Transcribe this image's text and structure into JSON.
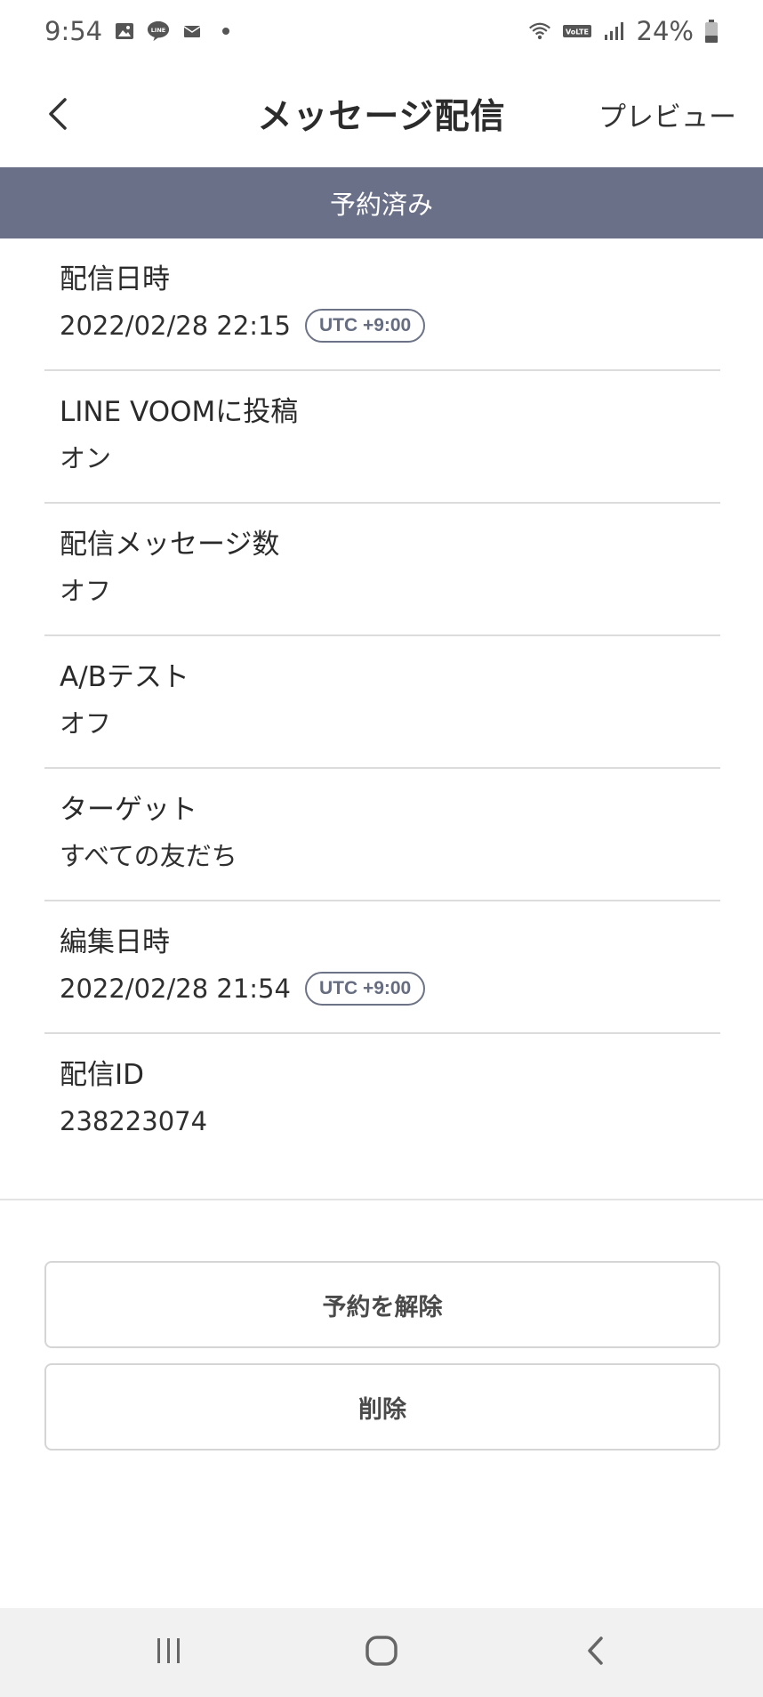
{
  "status_bar": {
    "time": "9:54",
    "battery": "24%",
    "left_icons": [
      "image-icon",
      "line-app-icon",
      "mail-icon",
      "dot-icon"
    ],
    "right_icons": [
      "wifi-icon",
      "volte-icon",
      "signal-icon",
      "battery-icon"
    ]
  },
  "header": {
    "title": "メッセージ配信",
    "back_icon": "chevron-left-icon",
    "preview_label": "プレビュー"
  },
  "banner": {
    "status_text": "予約済み",
    "color": "#6a7088"
  },
  "details": [
    {
      "label": "配信日時",
      "value": "2022/02/28 22:15",
      "badge": "UTC +9:00"
    },
    {
      "label": "LINE VOOMに投稿",
      "value": "オン"
    },
    {
      "label": "配信メッセージ数",
      "value": "オフ"
    },
    {
      "label": "A/Bテスト",
      "value": "オフ"
    },
    {
      "label": "ターゲット",
      "value": "すべての友だち"
    },
    {
      "label": "編集日時",
      "value": "2022/02/28 21:54",
      "badge": "UTC +9:00"
    },
    {
      "label": "配信ID",
      "value": "238223074"
    }
  ],
  "actions": {
    "cancel_reservation_label": "予約を解除",
    "delete_label": "削除"
  },
  "nav_bar": {
    "recent_icon": "recent-apps-icon",
    "home_icon": "home-icon",
    "back_icon": "back-icon"
  }
}
